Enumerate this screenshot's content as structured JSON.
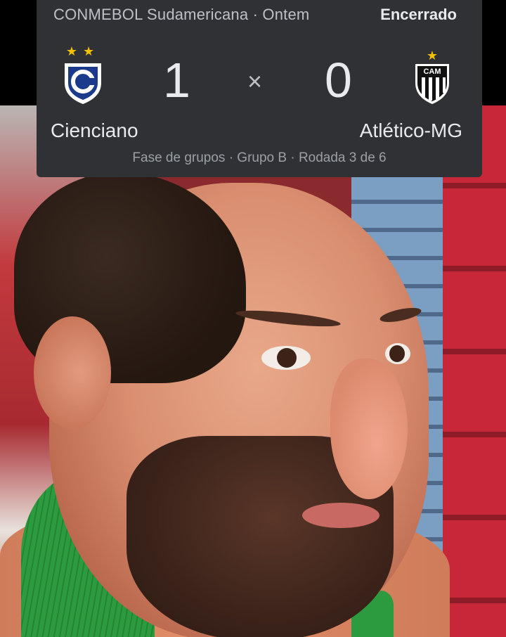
{
  "match": {
    "competition": "CONMEBOL Sudamericana · Ontem",
    "status": "Encerrado",
    "home": {
      "name": "Cienciano",
      "score": "1",
      "stars": "★★"
    },
    "away": {
      "name": "Atlético-MG",
      "score": "0",
      "stars": "★",
      "crest_text": "CAM"
    },
    "separator": "×",
    "phase": "Fase de grupos · Grupo B · Rodada 3 de 6"
  },
  "colors": {
    "card_bg": "#303134",
    "text_primary": "#e8eaed",
    "text_secondary": "#9aa0a6",
    "star": "#f2c200",
    "cienciano_blue": "#1b3a8c"
  },
  "icons": {
    "home_crest": "cienciano-crest-icon",
    "away_crest": "atletico-mg-crest-icon"
  }
}
